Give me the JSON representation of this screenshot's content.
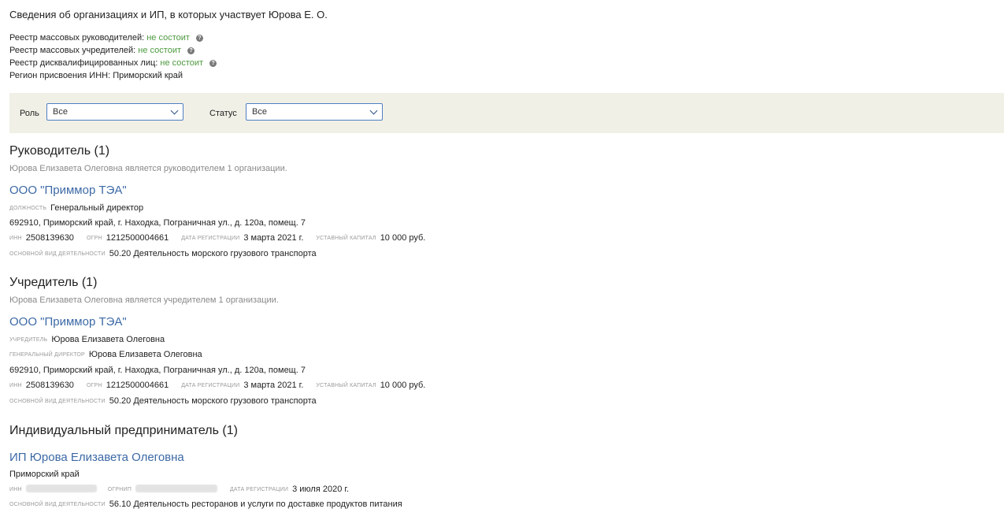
{
  "page_title": "Сведения об организациях и ИП, в которых участвует Юрова Е. О.",
  "registry": [
    {
      "label": "Реестр массовых руководителей:",
      "value": "не состоит",
      "has_help": true
    },
    {
      "label": "Реестр массовых учредителей:",
      "value": "не состоит",
      "has_help": true
    },
    {
      "label": "Реестр дисквалифицированных лиц:",
      "value": "не состоит",
      "has_help": true
    },
    {
      "label": "Регион присвоения ИНН:",
      "value": "Приморский край",
      "has_help": false
    }
  ],
  "filters": {
    "role_label": "Роль",
    "role_value": "Все",
    "status_label": "Статус",
    "status_value": "Все"
  },
  "leader": {
    "heading": "Руководитель (1)",
    "subtitle": "Юрова Елизавета Олеговна является руководителем 1 организации.",
    "org": {
      "name": "ООО \"Приммор ТЭА\"",
      "position_label": "должность",
      "position": "Генеральный директор",
      "address": "692910, Приморский край, г. Находка, Пограничная ул., д. 120а, помещ. 7",
      "inn_label": "ИНН",
      "inn": "2508139630",
      "ogrn_label": "ОГРН",
      "ogrn": "1212500004661",
      "reg_date_label": "дата регистрации",
      "reg_date": "3 марта 2021 г.",
      "capital_label": "уставный капитал",
      "capital": "10 000 руб.",
      "activity_label": "основной вид деятельности",
      "activity": "50.20 Деятельность морского грузового транспорта"
    }
  },
  "founder": {
    "heading": "Учредитель (1)",
    "subtitle": "Юрова Елизавета Олеговна является учредителем 1 организации.",
    "org": {
      "name": "ООО \"Приммор ТЭА\"",
      "founder_label": "учредитель",
      "founder": "Юрова Елизавета Олеговна",
      "director_label": "генеральный директор",
      "director": "Юрова Елизавета Олеговна",
      "address": "692910, Приморский край, г. Находка, Пограничная ул., д. 120а, помещ. 7",
      "inn_label": "ИНН",
      "inn": "2508139630",
      "ogrn_label": "ОГРН",
      "ogrn": "1212500004661",
      "reg_date_label": "дата регистрации",
      "reg_date": "3 марта 2021 г.",
      "capital_label": "уставный капитал",
      "capital": "10 000 руб.",
      "activity_label": "основной вид деятельности",
      "activity": "50.20 Деятельность морского грузового транспорта"
    }
  },
  "entrepreneur": {
    "heading": "Индивидуальный предприниматель (1)",
    "item": {
      "name": "ИП Юрова Елизавета Олеговна",
      "region": "Приморский край",
      "inn_label": "ИНН",
      "ogrnip_label": "ОГРНИП",
      "reg_date_label": "дата регистрации",
      "reg_date": "3 июля 2020 г.",
      "activity_label": "основной вид деятельности",
      "activity": "56.10 Деятельность ресторанов и услуги по доставке продуктов питания"
    }
  },
  "icons": {
    "help": "question-circle-icon",
    "dropdown": "chevron-down-icon"
  },
  "colors": {
    "link": "#3c69a6",
    "status_ok": "#4d9a3f",
    "filter_bg": "#f1f0e6",
    "select_border": "#4f7fc2"
  }
}
